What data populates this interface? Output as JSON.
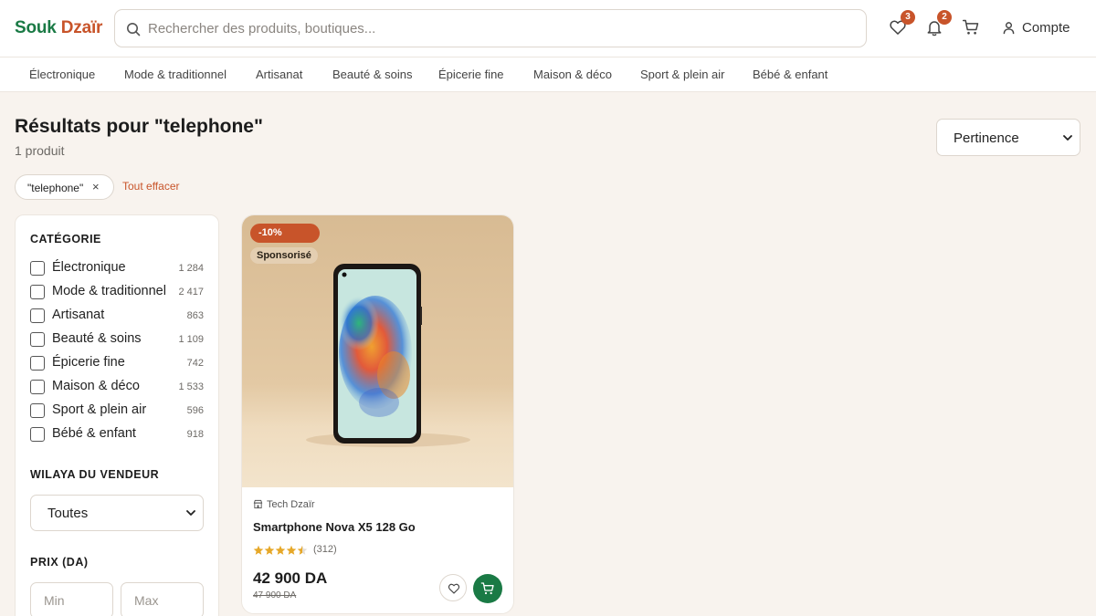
{
  "brand": {
    "part1": "Souk",
    "part2": "Dzaïr"
  },
  "search": {
    "placeholder": "Rechercher des produits, boutiques..."
  },
  "header": {
    "wishlist_count": "3",
    "notifications_count": "2",
    "account_label": "Compte"
  },
  "nav": {
    "categories": [
      "Électronique",
      "Mode & traditionnel",
      "Artisanat",
      "Beauté & soins",
      "Épicerie fine",
      "Maison & déco",
      "Sport & plein air",
      "Bébé & enfant"
    ]
  },
  "results": {
    "title": "Résultats pour \"telephone\"",
    "count": "1 produit",
    "sort_value": "Pertinence",
    "chip_label": "\"telephone\"",
    "chip_remove": "×",
    "clear_all": "Tout effacer"
  },
  "filters": {
    "category_heading": "CATÉGORIE",
    "categories": [
      {
        "label": "Électronique",
        "count": "1 284"
      },
      {
        "label": "Mode & traditionnel",
        "count": "2 417"
      },
      {
        "label": "Artisanat",
        "count": "863"
      },
      {
        "label": "Beauté & soins",
        "count": "1 109"
      },
      {
        "label": "Épicerie fine",
        "count": "742"
      },
      {
        "label": "Maison & déco",
        "count": "1 533"
      },
      {
        "label": "Sport & plein air",
        "count": "596"
      },
      {
        "label": "Bébé & enfant",
        "count": "918"
      }
    ],
    "wilaya_heading": "WILAYA DU VENDEUR",
    "wilaya_value": "Toutes",
    "price_heading": "PRIX (DA)",
    "price_min_placeholder": "Min",
    "price_max_placeholder": "Max"
  },
  "product": {
    "discount": "-10%",
    "sponsored": "Sponsorisé",
    "shop": "Tech Dzaïr",
    "name": "Smartphone Nova X5 128 Go",
    "rating": 4.5,
    "rating_max": 5,
    "reviews": "(312)",
    "price": "42 900 DA",
    "old_price": "47 900 DA"
  },
  "colors": {
    "brand_green": "#1a7a45",
    "brand_orange": "#c8542a",
    "page_bg": "#f8f3ee"
  }
}
